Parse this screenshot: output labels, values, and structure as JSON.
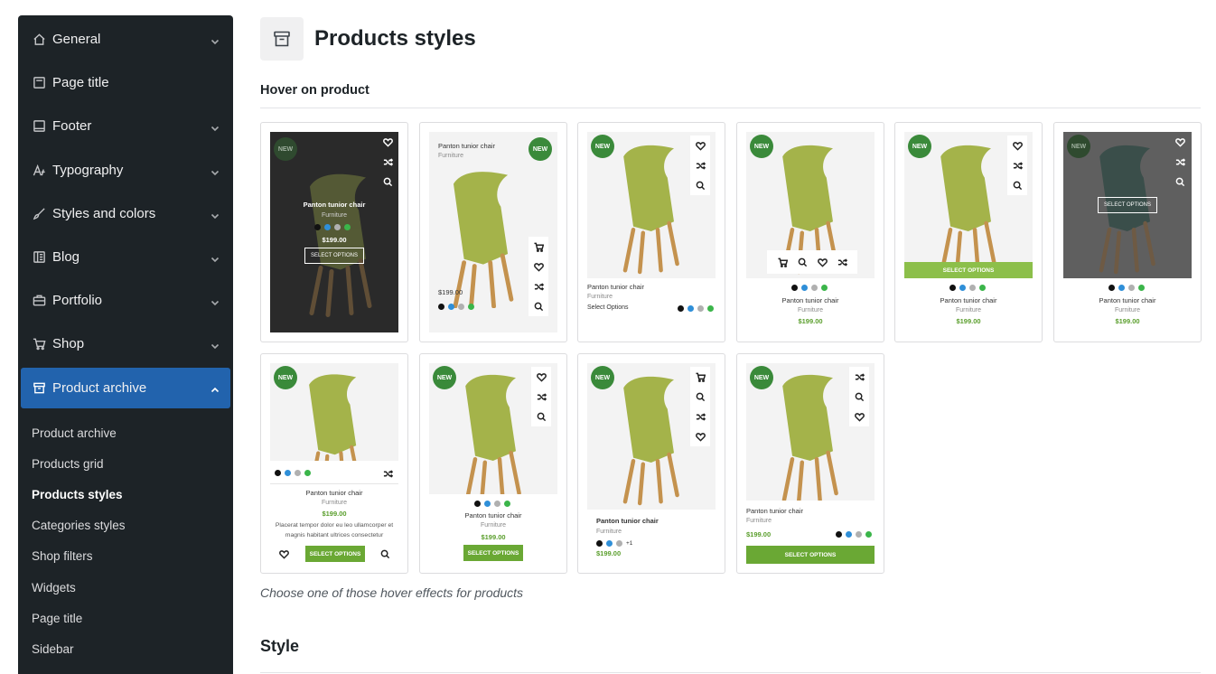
{
  "sidebar": {
    "items": [
      {
        "label": "General",
        "icon": "home-icon"
      },
      {
        "label": "Page title",
        "icon": "page-title-icon"
      },
      {
        "label": "Footer",
        "icon": "footer-icon"
      },
      {
        "label": "Typography",
        "icon": "typography-icon"
      },
      {
        "label": "Styles and colors",
        "icon": "brush-icon"
      },
      {
        "label": "Blog",
        "icon": "blog-icon"
      },
      {
        "label": "Portfolio",
        "icon": "briefcase-icon"
      },
      {
        "label": "Shop",
        "icon": "cart-icon"
      },
      {
        "label": "Product archive",
        "icon": "archive-icon"
      }
    ],
    "subitems": [
      {
        "label": "Product archive"
      },
      {
        "label": "Products grid"
      },
      {
        "label": "Products styles"
      },
      {
        "label": "Categories styles"
      },
      {
        "label": "Shop filters"
      },
      {
        "label": "Widgets"
      },
      {
        "label": "Page title"
      },
      {
        "label": "Sidebar"
      }
    ]
  },
  "header": {
    "title": "Products styles"
  },
  "section": {
    "label": "Hover on product"
  },
  "hint": "Choose one of those hover effects for products",
  "style_label": "Style",
  "product": {
    "badge": "NEW",
    "name": "Panton tunior chair",
    "category": "Furniture",
    "price": "$199.00",
    "select_upper": "SELECT OPTIONS",
    "select_title": "Select Options",
    "more_colors": "+1",
    "description": "Placerat tempor dolor eu leo ullamcorper et magnis habitant ultrices consectetur"
  },
  "colors": {
    "accent": "#2263ad",
    "sidebar_bg": "#1d2327",
    "badge_green": "#3a8a3a",
    "price_green": "#5a9e2c",
    "button_green": "#6aa834",
    "swatches": [
      "#111111",
      "#2f8fd8",
      "#b0b0b0",
      "#3bb54a"
    ]
  }
}
